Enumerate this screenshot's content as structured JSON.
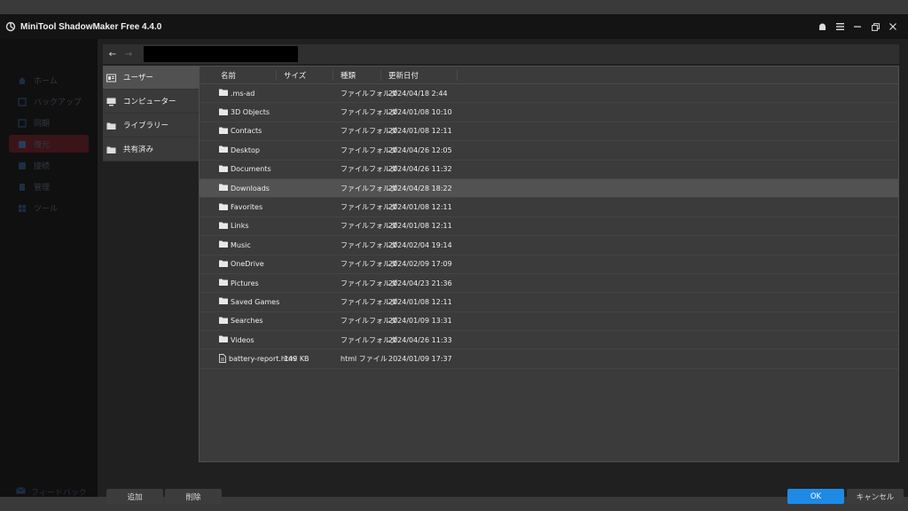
{
  "app": {
    "title": "MiniTool ShadowMaker Free 4.4.0"
  },
  "sidebar": {
    "items": [
      {
        "label": "ホーム",
        "active": false
      },
      {
        "label": "バックアップ",
        "active": false
      },
      {
        "label": "同期",
        "active": false
      },
      {
        "label": "復元",
        "active": true
      },
      {
        "label": "接続",
        "active": false
      },
      {
        "label": "管理",
        "active": false
      },
      {
        "label": "ツール",
        "active": false
      }
    ],
    "bottom_label": "フィードバック"
  },
  "dialog": {
    "path_value": "",
    "places": [
      {
        "label": "ユーザー",
        "icon": "user-folder-icon",
        "selected": true
      },
      {
        "label": "コンピューター",
        "icon": "computer-icon",
        "selected": false
      },
      {
        "label": "ライブラリー",
        "icon": "library-icon",
        "selected": false
      },
      {
        "label": "共有済み",
        "icon": "shared-folder-icon",
        "selected": false
      }
    ],
    "columns": {
      "name": "名前",
      "size": "サイズ",
      "type": "種類",
      "date": "更新日付"
    },
    "files": [
      {
        "name": ".ms-ad",
        "size": "",
        "type": "ファイルフォルダ",
        "date": "2024/04/18 2:44",
        "icon": "folder-icon"
      },
      {
        "name": "3D Objects",
        "size": "",
        "type": "ファイルフォルダ",
        "date": "2024/01/08 10:10",
        "icon": "folder-icon"
      },
      {
        "name": "Contacts",
        "size": "",
        "type": "ファイルフォルダ",
        "date": "2024/01/08 12:11",
        "icon": "folder-icon"
      },
      {
        "name": "Desktop",
        "size": "",
        "type": "ファイルフォルダ",
        "date": "2024/04/26 12:05",
        "icon": "folder-icon"
      },
      {
        "name": "Documents",
        "size": "",
        "type": "ファイルフォルダ",
        "date": "2024/04/26 11:32",
        "icon": "folder-icon"
      },
      {
        "name": "Downloads",
        "size": "",
        "type": "ファイルフォルダ",
        "date": "2024/04/28 18:22",
        "icon": "folder-icon",
        "highlight": true
      },
      {
        "name": "Favorites",
        "size": "",
        "type": "ファイルフォルダ",
        "date": "2024/01/08 12:11",
        "icon": "folder-icon"
      },
      {
        "name": "Links",
        "size": "",
        "type": "ファイルフォルダ",
        "date": "2024/01/08 12:11",
        "icon": "folder-icon"
      },
      {
        "name": "Music",
        "size": "",
        "type": "ファイルフォルダ",
        "date": "2024/02/04 19:14",
        "icon": "folder-icon"
      },
      {
        "name": "OneDrive",
        "size": "",
        "type": "ファイルフォルダ",
        "date": "2024/02/09 17:09",
        "icon": "folder-icon"
      },
      {
        "name": "Pictures",
        "size": "",
        "type": "ファイルフォルダ",
        "date": "2024/04/23 21:36",
        "icon": "folder-icon"
      },
      {
        "name": "Saved Games",
        "size": "",
        "type": "ファイルフォルダ",
        "date": "2024/01/08 12:11",
        "icon": "folder-icon"
      },
      {
        "name": "Searches",
        "size": "",
        "type": "ファイルフォルダ",
        "date": "2024/01/09 13:31",
        "icon": "folder-icon"
      },
      {
        "name": "Videos",
        "size": "",
        "type": "ファイルフォルダ",
        "date": "2024/04/26 11:33",
        "icon": "folder-icon"
      },
      {
        "name": "battery-report.html",
        "size": "149 KB",
        "type": "html ファイル",
        "date": "2024/01/09 17:37",
        "icon": "file-icon"
      }
    ],
    "buttons": {
      "add": "追加",
      "delete": "削除",
      "ok": "OK",
      "cancel": "キャンセル"
    },
    "accent_color": "#1e8ae6"
  }
}
